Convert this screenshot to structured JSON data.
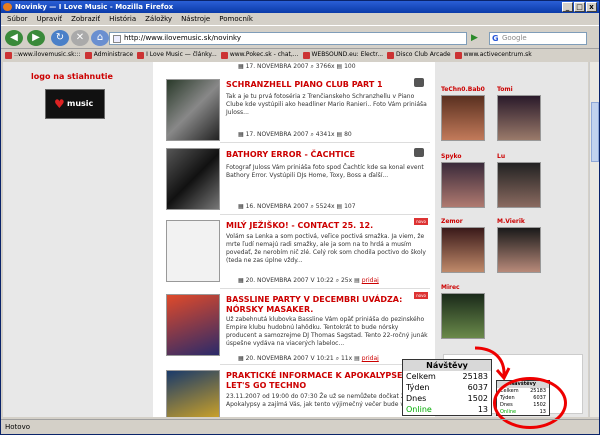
{
  "window": {
    "title": "Novinky — I Love Music - Mozilla Firefox",
    "buttons": [
      "_",
      "□",
      "x"
    ]
  },
  "menu": [
    "Súbor",
    "Upraviť",
    "Zobraziť",
    "História",
    "Záložky",
    "Nástroje",
    "Pomocník"
  ],
  "url": "http://www.ilovemusic.sk/novinky",
  "search_placeholder": "Google",
  "bookmarks": [
    "::www.ilovemusic.sk:::",
    "Administrace",
    "I Love Music — články...",
    "www.Pokec.sk - chat,...",
    "WEBSOUND.eu: Electr...",
    "Disco Club Arcade",
    "www.activecentrum.sk"
  ],
  "left": {
    "logo_title": "logo na stiahnutie",
    "logo_text": "music"
  },
  "articles": [
    {
      "title": "",
      "meta_date": "17. NOVEMBRA 2007",
      "meta_views": "3766x",
      "meta_comments": "100"
    },
    {
      "title": "SCHRANZHELL PIANO CLUB PART 1",
      "text": "Tak a je tu prvá fotoséria z Trenčianskeho Schranzhellu v Piano Clube kde vystúpili ako headliner Mario Ranieri.. Foto Vám priniáša Juloss...",
      "meta_date": "17. NOVEMBRA 2007",
      "meta_views": "4341x",
      "meta_comments": "80"
    },
    {
      "title": "BATHORY ERROR - ČACHTICE",
      "text": "Fotograf Juloss Vám priniáša foto spod Čachtíc kde sa konal event Bathory Error. Vystúpili DJs Home, Toxy, Boss a ďalší...",
      "meta_date": "16. NOVEMBRA 2007",
      "meta_views": "5524x",
      "meta_comments": "107"
    },
    {
      "title": "MILÝ JEŽIŠKO! - CONTACT 25. 12.",
      "text": "Volám sa Lenka a som poctivá, veľice poctivá smažka. Ja viem, že mrte ľudí nemajú radi smažky, ale ja som na to hrdá a musím povedať, že nerobím nič zlé. Celý rok som chodila poctivo do školy (teda ne zas úplne vždy...",
      "meta_date": "20. NOVEMBRA 2007 V 10:22",
      "meta_views": "25x",
      "meta_comments": "pridaj",
      "badge": "novo"
    },
    {
      "title": "BASSLINE PARTY V DECEMBRI UVÁDZA: NÓRSKY MASAKER.",
      "text": "Už zabehnutá klubovka Bassline Vám opäť priniáša do pezinského Empire klubu hudobnú lahôdku. Tentokrát to bude nórsky producent a samozrejme DJ Thomas Sagstad. Tento 22-ročný junák úspešne vydáva na viacerých labeloc...",
      "meta_date": "20. NOVEMBRA 2007 V 10:21",
      "meta_views": "11x",
      "meta_comments": "pridaj",
      "badge": "novo"
    },
    {
      "title": "PRAKTICKÉ INFORMACE K APOKALYPSE LET'S GO TECHNO",
      "text": "23.11.2007 od 19:00 do 07:30 Že už se nemůžete dočkat 27. Apokalypsy a zajímá Vás, jak tento výjimečný večer bude vyp...",
      "badge": "novo"
    }
  ],
  "users": [
    "TeChn0.Bab0",
    "Tomi",
    "Spyko",
    "Lu",
    "Zemor",
    "M.Vierik",
    "Mirec"
  ],
  "stats_big": {
    "header": "Návštěvy",
    "rows": [
      [
        "Celkem",
        "25183"
      ],
      [
        "Týden",
        "6037"
      ],
      [
        "Dnes",
        "1502"
      ],
      [
        "Online",
        "13"
      ]
    ]
  },
  "stats_small": {
    "header": "Návštěvy",
    "rows": [
      [
        "Celkem",
        "25183"
      ],
      [
        "Týden",
        "6037"
      ],
      [
        "Dnes",
        "1502"
      ],
      [
        "Online",
        "13"
      ]
    ]
  },
  "status": "Hotovo"
}
